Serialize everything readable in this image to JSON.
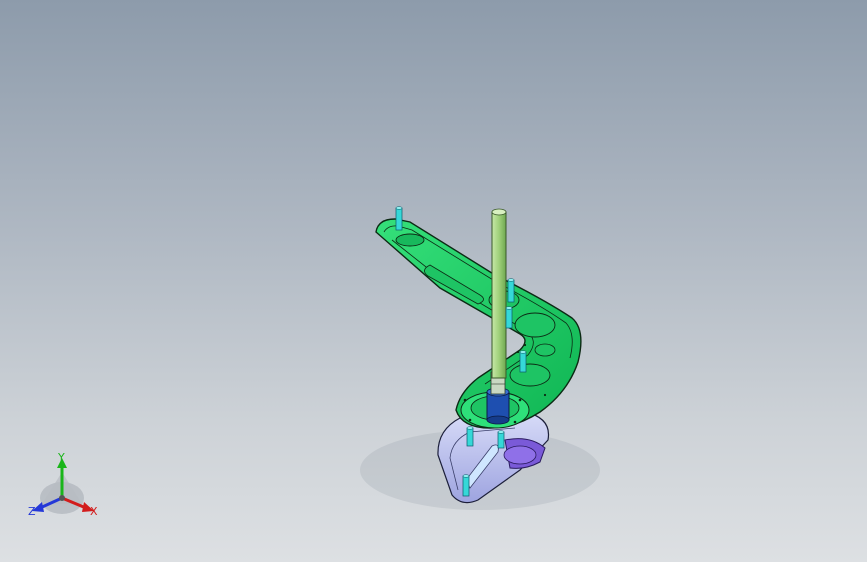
{
  "viewport": {
    "background_top": "#8d9bab",
    "background_bottom": "#dde0e3"
  },
  "model": {
    "arm_color": "#22d06a",
    "arm_outline": "#0c2a14",
    "shaft_color": "#9fd07a",
    "pin_color": "#35d8d8",
    "base_color": "#b9bdf0",
    "motor_color": "#7a5ad8",
    "coupling_color": "#1e4fb0"
  },
  "triad": {
    "x_label": "X",
    "y_label": "Y",
    "z_label": "Z",
    "x_color": "#d21c1c",
    "y_color": "#1ab51a",
    "z_color": "#2438d8"
  }
}
